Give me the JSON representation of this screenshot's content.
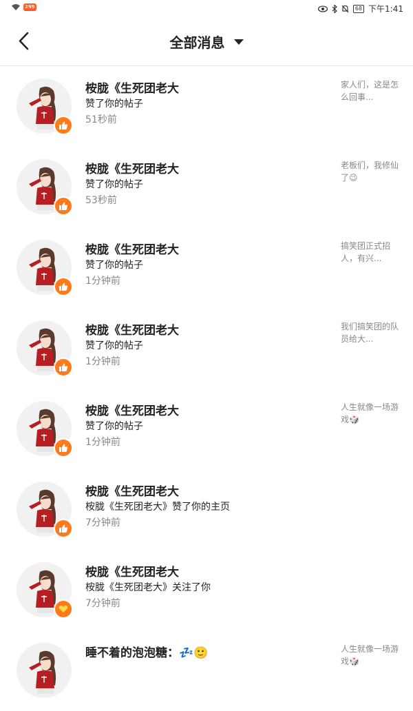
{
  "status_bar": {
    "app_badge": "299",
    "battery": "68",
    "time": "下午1:41"
  },
  "nav": {
    "title": "全部消息"
  },
  "notifications": [
    {
      "name": "桉胧《生死团老大",
      "action": "赞了你的帖子",
      "time": "51秒前",
      "preview": "家人们，这是怎么回事...",
      "badge": "thumbs-up"
    },
    {
      "name": "桉胧《生死团老大",
      "action": "赞了你的帖子",
      "time": "53秒前",
      "preview": "老板们，我修仙了😉",
      "badge": "thumbs-up"
    },
    {
      "name": "桉胧《生死团老大",
      "action": "赞了你的帖子",
      "time": "1分钟前",
      "preview": "搞笑团正式招人，有兴...",
      "badge": "thumbs-up"
    },
    {
      "name": "桉胧《生死团老大",
      "action": "赞了你的帖子",
      "time": "1分钟前",
      "preview": "我们搞笑团的队员给大...",
      "badge": "thumbs-up"
    },
    {
      "name": "桉胧《生死团老大",
      "action": "赞了你的帖子",
      "time": "1分钟前",
      "preview": "人生就像一场游戏🎲",
      "badge": "thumbs-up"
    },
    {
      "name": "桉胧《生死团老大",
      "action": "桉胧《生死团老大》赞了你的主页",
      "time": "7分钟前",
      "preview": "",
      "badge": "thumbs-up"
    },
    {
      "name": "桉胧《生死团老大",
      "action": "桉胧《生死团老大》关注了你",
      "time": "7分钟前",
      "preview": "",
      "badge": "heart"
    },
    {
      "name": "睡不着的泡泡糖：💤🙂",
      "action": "",
      "time": "",
      "preview": "人生就像一场游戏🎲",
      "badge": ""
    }
  ],
  "colors": {
    "badge_orange": "#ff7a1a",
    "avatar_bg": "#f1f1f1",
    "secondary_text": "#888888"
  }
}
